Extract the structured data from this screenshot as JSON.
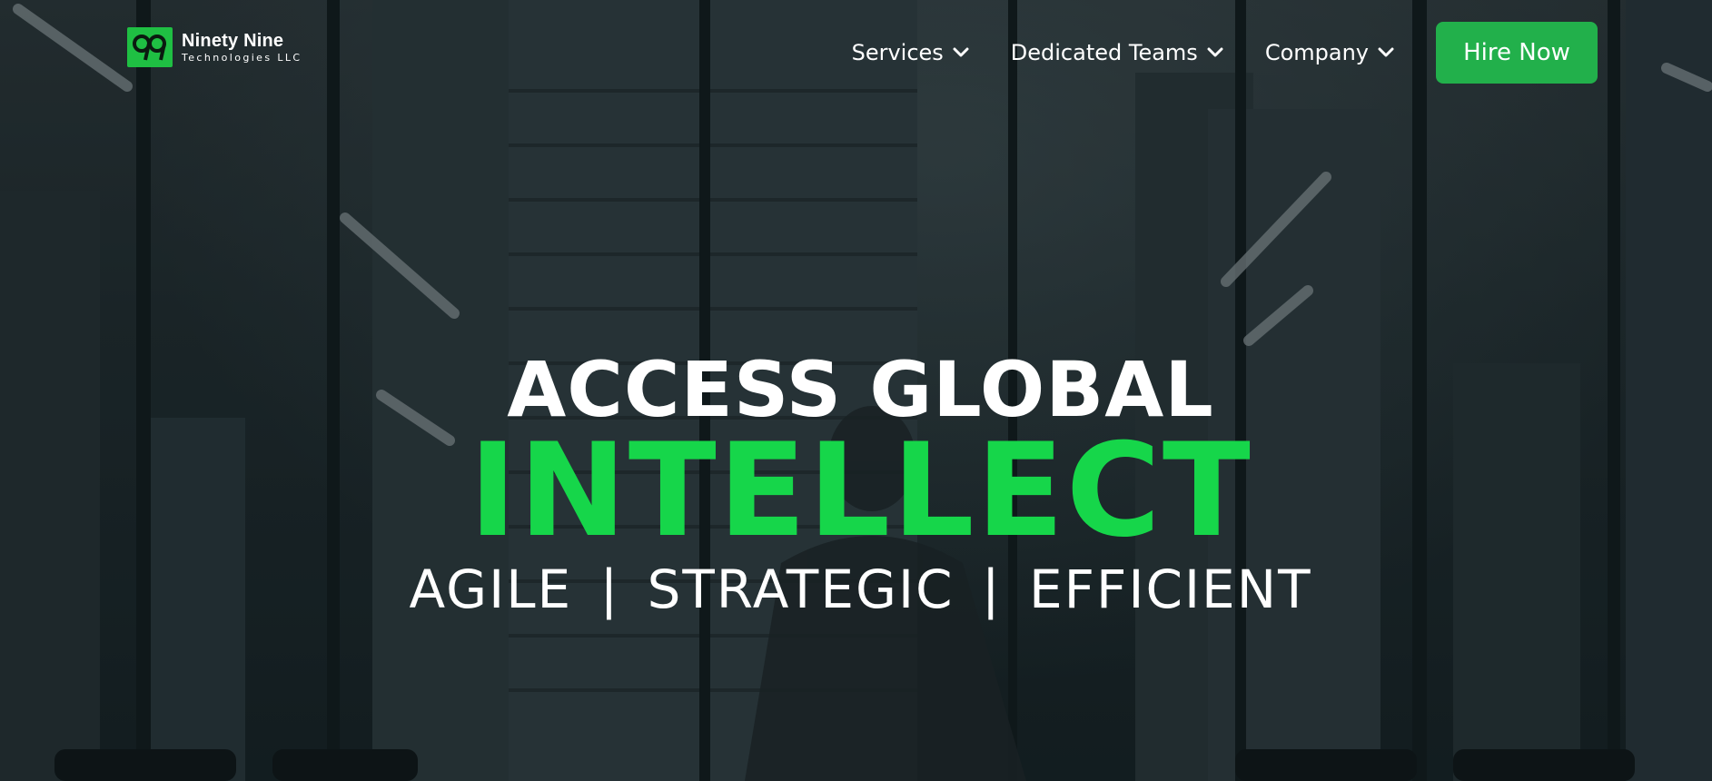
{
  "brand": {
    "logo_mark": "99",
    "name": "Ninety Nine",
    "subtitle": "Technologies LLC",
    "accent_color": "#1fbf43"
  },
  "nav": {
    "items": [
      {
        "label": "Services",
        "icon": "chevron-down-icon"
      },
      {
        "label": "Dedicated Teams",
        "icon": "chevron-down-icon"
      },
      {
        "label": "Company",
        "icon": "chevron-down-icon"
      }
    ],
    "cta_label": "Hire Now",
    "cta_color": "#22b04b"
  },
  "hero": {
    "headline_line1": "ACCESS GLOBAL",
    "headline_line2": "INTELLECT",
    "headline_line2_color": "#16d64a",
    "tagline": "AGILE | STRATEGIC | EFFICIENT",
    "background": "city-skyline-office-photo"
  }
}
